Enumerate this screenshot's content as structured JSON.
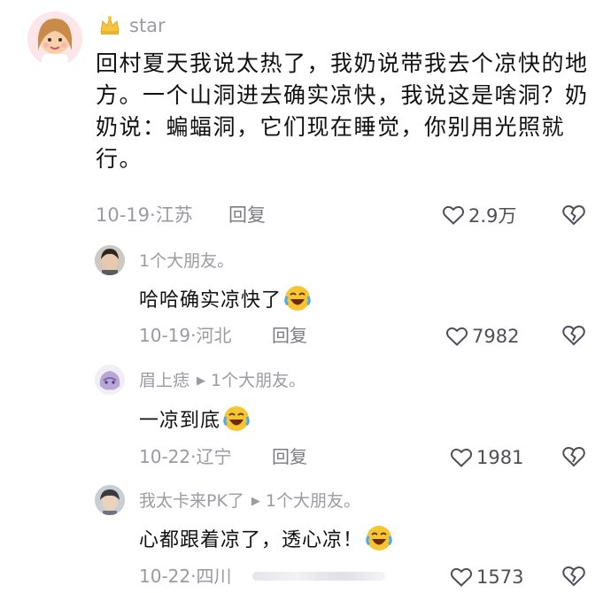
{
  "main_comment": {
    "username": "star",
    "text": "回村夏天我说太热了，我奶说带我去个凉快的地方。一个山洞进去确实凉快，我说这是啥洞？奶奶说：蝙蝠洞，它们现在睡觉，你别用光照就行。",
    "date": "10-19",
    "location": "江苏",
    "reply_label": "回复",
    "likes": "2.9万"
  },
  "replies": [
    {
      "username": "1个大朋友。",
      "reply_to": "",
      "text": "哈哈确实凉快了",
      "emoji": "crying-laughing-emoji",
      "date": "10-19",
      "location": "河北",
      "reply_label": "回复",
      "likes": "7982"
    },
    {
      "username": "眉上痣",
      "reply_to": "1个大朋友。",
      "text": "一凉到底",
      "emoji": "crying-laughing-emoji",
      "date": "10-22",
      "location": "辽宁",
      "reply_label": "回复",
      "likes": "1981"
    },
    {
      "username": "我太卡来PK了",
      "reply_to": "1个大朋友。",
      "text": "心都跟着凉了，透心凉！",
      "emoji": "crying-laughing-emoji",
      "date": "10-22",
      "location": "四川",
      "reply_label": "",
      "likes": "1573"
    }
  ],
  "separator": "·",
  "icons": {
    "like": "heart-outline-icon",
    "dislike": "broken-heart-icon",
    "reply_arrow": "triangle-right-icon",
    "badge": "crown-icon"
  },
  "colors": {
    "meta_text": "#9a9aa2",
    "body_text": "#111111",
    "icon_stroke": "#4e4e56",
    "emoji_yellow": "#f7c531"
  }
}
